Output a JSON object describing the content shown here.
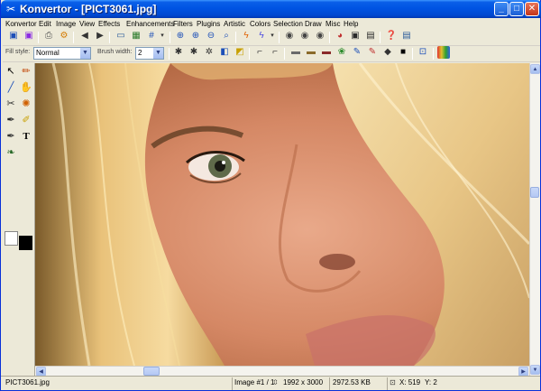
{
  "window": {
    "title": "Konvertor - [PICT3061.jpg]",
    "controls": {
      "minimize": "_",
      "maximize": "□",
      "close": "✕"
    }
  },
  "menu": [
    "Konvertor",
    "Edit",
    "Image",
    "View",
    "Effects",
    "Enhancements",
    "Filters",
    "Plugins",
    "Artistic",
    "Colors",
    "Selection",
    "Draw",
    "Misc",
    "Help"
  ],
  "toolbar2": {
    "fill_style_label": "Fill style:",
    "fill_style_value": "Normal",
    "brush_width_label": "Brush width:",
    "brush_width_value": "2"
  },
  "status": {
    "filename": "PICT3061.jpg",
    "image_index": "Image #1 / 1",
    "dimensions": "1992 x 3000",
    "filesize": "2972.53 KB",
    "cursor_x": "X: 519",
    "cursor_y": "Y: 2"
  },
  "colors": {
    "titlebar": "#0054e3",
    "foreground": "#000000",
    "background": "#ffffff"
  }
}
